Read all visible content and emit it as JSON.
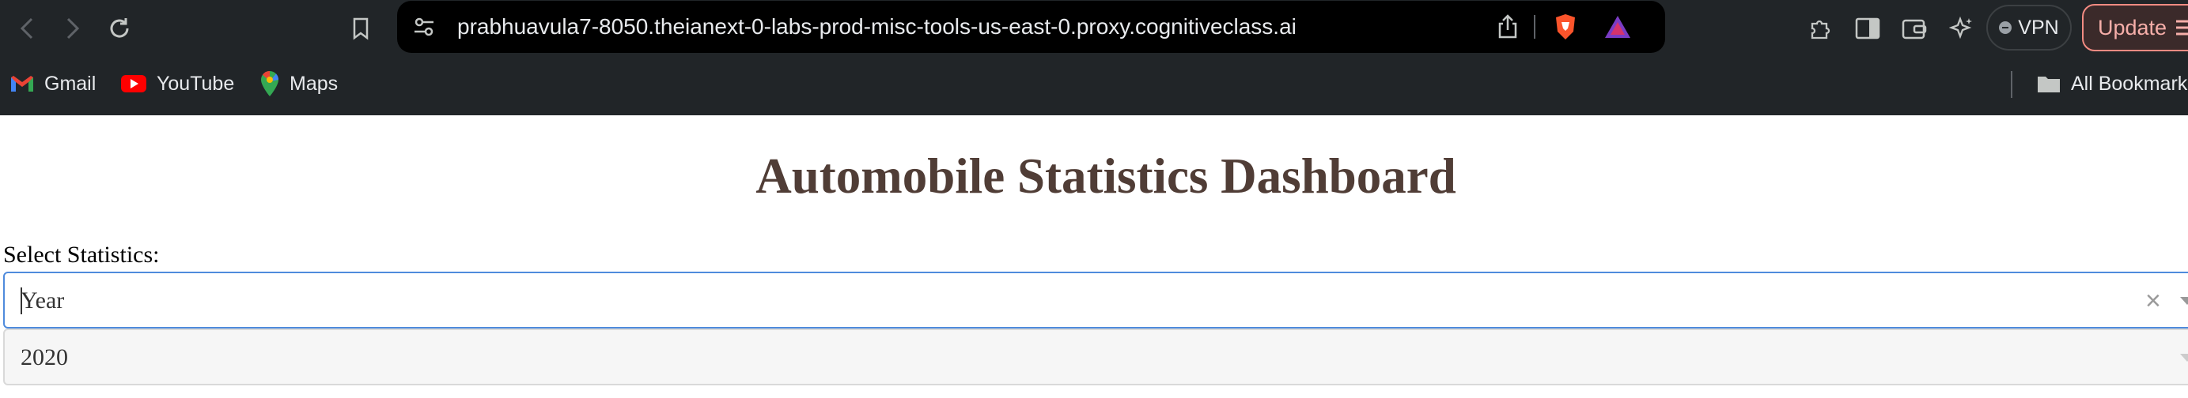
{
  "browser": {
    "url": "prabhuavula7-8050.theianext-0-labs-prod-misc-tools-us-east-0.proxy.cognitiveclass.ai",
    "vpn_label": "VPN",
    "update_label": "Update"
  },
  "bookmarks": {
    "items": [
      {
        "label": "Gmail",
        "icon": "gmail-icon"
      },
      {
        "label": "YouTube",
        "icon": "youtube-icon"
      },
      {
        "label": "Maps",
        "icon": "maps-icon"
      }
    ],
    "all_bookmarks_label": "All Bookmarks"
  },
  "page": {
    "title": "Automobile Statistics Dashboard",
    "select_label": "Select Statistics:",
    "statistics_dropdown": {
      "value": "Year"
    },
    "year_dropdown": {
      "value": "2020"
    }
  },
  "colors": {
    "title": "#503d36",
    "chrome_bg": "#212528",
    "focus_border": "#4f8bdc"
  }
}
